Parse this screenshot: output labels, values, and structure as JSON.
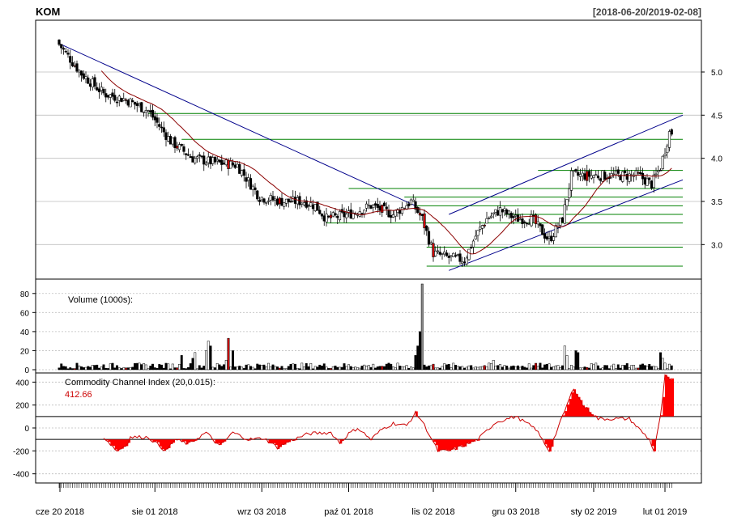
{
  "header": {
    "ticker": "KOM",
    "date_range": "[2018-06-20/2019-02-08]"
  },
  "colors": {
    "up_candle": "#ffffff",
    "down_candle": "#000000",
    "highlight_candle": "#cc0000",
    "moving_average": "#8b0000",
    "trend_line": "#00008b",
    "support_line": "#008000",
    "cci_fill": "#ff0000",
    "grid": "#bdbdbd"
  },
  "price_panel": {
    "y_ticks": [
      "5.0",
      "4.5",
      "4.0",
      "3.5",
      "3.0"
    ]
  },
  "volume_panel": {
    "label": "Volume (1000s):",
    "y_ticks": [
      "80",
      "60",
      "40",
      "20",
      "0"
    ]
  },
  "cci_panel": {
    "label": "Commodity Channel Index (20,0.015):",
    "last_value": "412.66",
    "y_ticks": [
      "400",
      "200",
      "0",
      "-200",
      "-400"
    ]
  },
  "x_axis": {
    "tick_labels": [
      "cze 20 2018",
      "sie 01 2018",
      "wrz 03 2018",
      "paź 01 2018",
      "lis 02 2018",
      "gru 03 2018",
      "sty 02 2019",
      "lut 01 2019"
    ]
  },
  "chart_data": {
    "type": "candlestick",
    "ticker": "KOM",
    "date_range": "[2018-06-20/2019-02-08]",
    "price": {
      "ylim": [
        2.6,
        5.6
      ],
      "anchors": [
        [
          0,
          5.32
        ],
        [
          10,
          4.98
        ],
        [
          20,
          4.75
        ],
        [
          30,
          4.68
        ],
        [
          40,
          4.55
        ],
        [
          50,
          4.2
        ],
        [
          60,
          4.0
        ],
        [
          70,
          3.95
        ],
        [
          80,
          3.92
        ],
        [
          90,
          3.55
        ],
        [
          100,
          3.5
        ],
        [
          110,
          3.5
        ],
        [
          115,
          3.45
        ],
        [
          120,
          3.3
        ],
        [
          130,
          3.35
        ],
        [
          140,
          3.45
        ],
        [
          150,
          3.35
        ],
        [
          158,
          3.5
        ],
        [
          163,
          3.3
        ],
        [
          168,
          2.9
        ],
        [
          175,
          2.85
        ],
        [
          182,
          2.82
        ],
        [
          187,
          3.1
        ],
        [
          192,
          3.3
        ],
        [
          198,
          3.4
        ],
        [
          205,
          3.3
        ],
        [
          212,
          3.3
        ],
        [
          220,
          3.05
        ],
        [
          226,
          3.3
        ],
        [
          230,
          3.8
        ],
        [
          240,
          3.8
        ],
        [
          250,
          3.8
        ],
        [
          260,
          3.8
        ],
        [
          266,
          3.7
        ],
        [
          270,
          3.9
        ],
        [
          274,
          4.3
        ]
      ],
      "moving_average_period": 20,
      "trend_lines": [
        {
          "from": [
            0,
            5.33
          ],
          "to": [
            160,
            3.45
          ]
        },
        {
          "from": [
            175,
            3.35
          ],
          "to": [
            280,
            4.5
          ]
        },
        {
          "from": [
            175,
            2.7
          ],
          "to": [
            280,
            3.75
          ]
        }
      ],
      "support_lines": [
        {
          "from": [
            40,
            4.52
          ],
          "to": [
            280,
            4.52
          ]
        },
        {
          "from": [
            55,
            4.22
          ],
          "to": [
            280,
            4.22
          ]
        },
        {
          "from": [
            215,
            3.86
          ],
          "to": [
            280,
            3.86
          ]
        },
        {
          "from": [
            130,
            3.65
          ],
          "to": [
            280,
            3.65
          ]
        },
        {
          "from": [
            155,
            3.55
          ],
          "to": [
            280,
            3.55
          ]
        },
        {
          "from": [
            160,
            3.45
          ],
          "to": [
            280,
            3.45
          ]
        },
        {
          "from": [
            120,
            3.25
          ],
          "to": [
            280,
            3.25
          ]
        },
        {
          "from": [
            200,
            3.35
          ],
          "to": [
            280,
            3.35
          ]
        },
        {
          "from": [
            165,
            2.97
          ],
          "to": [
            280,
            2.97
          ]
        },
        {
          "from": [
            165,
            2.75
          ],
          "to": [
            280,
            2.75
          ]
        }
      ]
    },
    "volume": {
      "ylim": [
        0,
        90
      ],
      "spikes": [
        [
          55,
          15
        ],
        [
          60,
          12
        ],
        [
          61,
          18
        ],
        [
          66,
          20
        ],
        [
          67,
          30
        ],
        [
          68,
          25
        ],
        [
          75,
          10
        ],
        [
          76,
          33
        ],
        [
          78,
          20
        ],
        [
          160,
          15
        ],
        [
          161,
          25
        ],
        [
          162,
          40
        ],
        [
          163,
          90
        ],
        [
          195,
          10
        ],
        [
          227,
          25
        ],
        [
          228,
          15
        ],
        [
          232,
          20
        ],
        [
          233,
          18
        ],
        [
          270,
          18
        ],
        [
          271,
          12
        ]
      ]
    },
    "cci": {
      "ylim": [
        -480,
        480
      ],
      "period": 20,
      "start_index": 20,
      "anchors": [
        [
          20,
          -80
        ],
        [
          26,
          -200
        ],
        [
          30,
          -150
        ],
        [
          32,
          -80
        ],
        [
          40,
          -80
        ],
        [
          48,
          -200
        ],
        [
          52,
          -100
        ],
        [
          58,
          -140
        ],
        [
          66,
          -40
        ],
        [
          72,
          -160
        ],
        [
          78,
          -40
        ],
        [
          85,
          -100
        ],
        [
          92,
          -90
        ],
        [
          98,
          -170
        ],
        [
          104,
          -110
        ],
        [
          112,
          -50
        ],
        [
          122,
          -40
        ],
        [
          126,
          -130
        ],
        [
          130,
          -50
        ],
        [
          134,
          0
        ],
        [
          140,
          -100
        ],
        [
          145,
          -10
        ],
        [
          150,
          40
        ],
        [
          156,
          20
        ],
        [
          160,
          130
        ],
        [
          163,
          60
        ],
        [
          170,
          -200
        ],
        [
          175,
          -200
        ],
        [
          182,
          -150
        ],
        [
          188,
          -100
        ],
        [
          196,
          50
        ],
        [
          205,
          100
        ],
        [
          214,
          -10
        ],
        [
          220,
          -200
        ],
        [
          226,
          100
        ],
        [
          231,
          350
        ],
        [
          235,
          200
        ],
        [
          242,
          80
        ],
        [
          256,
          80
        ],
        [
          265,
          -100
        ],
        [
          267,
          -200
        ],
        [
          270,
          100
        ],
        [
          272,
          450
        ],
        [
          274,
          420
        ]
      ],
      "reference_lines": [
        100,
        -100
      ]
    }
  }
}
